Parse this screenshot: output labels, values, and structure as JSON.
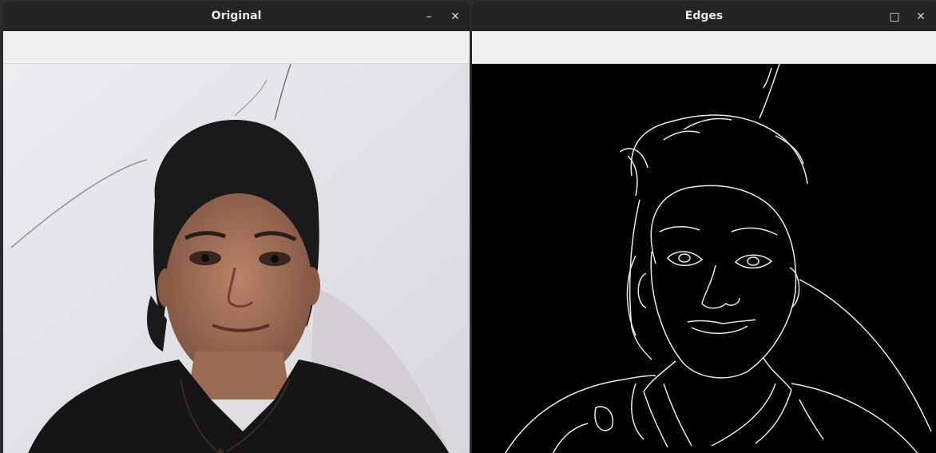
{
  "windows": {
    "original": {
      "title": "Original",
      "controls": {
        "minimize": "–",
        "close": "✕"
      }
    },
    "edges": {
      "title": "Edges",
      "controls": {
        "maximize": "□",
        "close": "✕"
      }
    }
  },
  "colors": {
    "titlebar": "#242424",
    "toolbar": "#f0f0f0",
    "photo_background": "#e6e5e9",
    "edges_background": "#000000",
    "edge_lines": "#e8e8e8"
  }
}
